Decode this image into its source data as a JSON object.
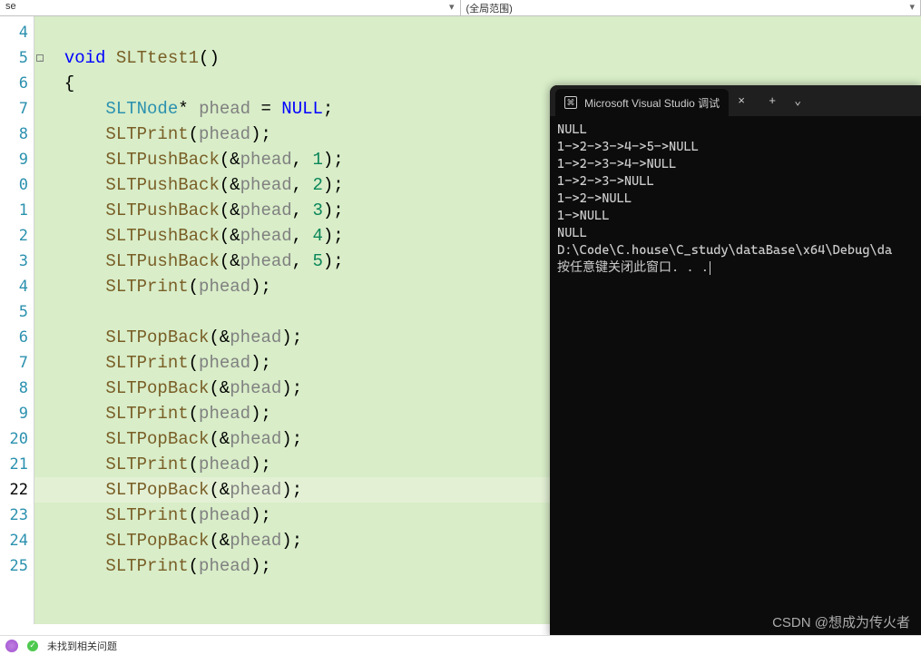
{
  "topbar": {
    "left_dropdown": "se",
    "right_dropdown": "(全局范围)"
  },
  "code": {
    "lines": [
      {
        "n": "4",
        "t": []
      },
      {
        "n": "5",
        "t": [
          {
            "s": "  ",
            "c": ""
          },
          {
            "s": "void",
            "c": "k-blue"
          },
          {
            "s": " ",
            "c": ""
          },
          {
            "s": "SLTtest1",
            "c": "k-func"
          },
          {
            "s": "()",
            "c": "k-par"
          }
        ],
        "outline": true
      },
      {
        "n": "6",
        "t": [
          {
            "s": "  {",
            "c": "k-par"
          }
        ]
      },
      {
        "n": "7",
        "t": [
          {
            "s": "      ",
            "c": ""
          },
          {
            "s": "SLTNode",
            "c": "k-type"
          },
          {
            "s": "* ",
            "c": "k-op"
          },
          {
            "s": "phead",
            "c": "hl-phead"
          },
          {
            "s": " = ",
            "c": "k-op"
          },
          {
            "s": "NULL",
            "c": "k-null"
          },
          {
            "s": ";",
            "c": "k-op"
          }
        ]
      },
      {
        "n": "8",
        "t": [
          {
            "s": "      ",
            "c": ""
          },
          {
            "s": "SLTPrint",
            "c": "k-func"
          },
          {
            "s": "(",
            "c": "k-par"
          },
          {
            "s": "phead",
            "c": "hl-phead"
          },
          {
            "s": ")",
            "c": "k-par"
          },
          {
            "s": ";",
            "c": "k-op"
          }
        ]
      },
      {
        "n": "9",
        "t": [
          {
            "s": "      ",
            "c": ""
          },
          {
            "s": "SLTPushBack",
            "c": "k-func"
          },
          {
            "s": "(&",
            "c": "k-par"
          },
          {
            "s": "phead",
            "c": "hl-phead"
          },
          {
            "s": ", ",
            "c": "k-op"
          },
          {
            "s": "1",
            "c": "k-num"
          },
          {
            "s": ")",
            "c": "k-par"
          },
          {
            "s": ";",
            "c": "k-op"
          }
        ]
      },
      {
        "n": "0",
        "t": [
          {
            "s": "      ",
            "c": ""
          },
          {
            "s": "SLTPushBack",
            "c": "k-func"
          },
          {
            "s": "(&",
            "c": "k-par"
          },
          {
            "s": "phead",
            "c": "hl-phead"
          },
          {
            "s": ", ",
            "c": "k-op"
          },
          {
            "s": "2",
            "c": "k-num"
          },
          {
            "s": ")",
            "c": "k-par"
          },
          {
            "s": ";",
            "c": "k-op"
          }
        ]
      },
      {
        "n": "1",
        "t": [
          {
            "s": "      ",
            "c": ""
          },
          {
            "s": "SLTPushBack",
            "c": "k-func"
          },
          {
            "s": "(&",
            "c": "k-par"
          },
          {
            "s": "phead",
            "c": "hl-phead"
          },
          {
            "s": ", ",
            "c": "k-op"
          },
          {
            "s": "3",
            "c": "k-num"
          },
          {
            "s": ")",
            "c": "k-par"
          },
          {
            "s": ";",
            "c": "k-op"
          }
        ]
      },
      {
        "n": "2",
        "t": [
          {
            "s": "      ",
            "c": ""
          },
          {
            "s": "SLTPushBack",
            "c": "k-func"
          },
          {
            "s": "(&",
            "c": "k-par"
          },
          {
            "s": "phead",
            "c": "hl-phead"
          },
          {
            "s": ", ",
            "c": "k-op"
          },
          {
            "s": "4",
            "c": "k-num"
          },
          {
            "s": ")",
            "c": "k-par"
          },
          {
            "s": ";",
            "c": "k-op"
          }
        ]
      },
      {
        "n": "3",
        "t": [
          {
            "s": "      ",
            "c": ""
          },
          {
            "s": "SLTPushBack",
            "c": "k-func"
          },
          {
            "s": "(&",
            "c": "k-par"
          },
          {
            "s": "phead",
            "c": "hl-phead"
          },
          {
            "s": ", ",
            "c": "k-op"
          },
          {
            "s": "5",
            "c": "k-num"
          },
          {
            "s": ")",
            "c": "k-par"
          },
          {
            "s": ";",
            "c": "k-op"
          }
        ]
      },
      {
        "n": "4",
        "t": [
          {
            "s": "      ",
            "c": ""
          },
          {
            "s": "SLTPrint",
            "c": "k-func"
          },
          {
            "s": "(",
            "c": "k-par"
          },
          {
            "s": "phead",
            "c": "hl-phead"
          },
          {
            "s": ")",
            "c": "k-par"
          },
          {
            "s": ";",
            "c": "k-op"
          }
        ]
      },
      {
        "n": "5",
        "t": []
      },
      {
        "n": "6",
        "t": [
          {
            "s": "      ",
            "c": ""
          },
          {
            "s": "SLTPopBack",
            "c": "k-func"
          },
          {
            "s": "(&",
            "c": "k-par"
          },
          {
            "s": "phead",
            "c": "hl-phead"
          },
          {
            "s": ")",
            "c": "k-par"
          },
          {
            "s": ";",
            "c": "k-op"
          }
        ]
      },
      {
        "n": "7",
        "t": [
          {
            "s": "      ",
            "c": ""
          },
          {
            "s": "SLTPrint",
            "c": "k-func"
          },
          {
            "s": "(",
            "c": "k-par"
          },
          {
            "s": "phead",
            "c": "hl-phead"
          },
          {
            "s": ")",
            "c": "k-par"
          },
          {
            "s": ";",
            "c": "k-op"
          }
        ]
      },
      {
        "n": "8",
        "t": [
          {
            "s": "      ",
            "c": ""
          },
          {
            "s": "SLTPopBack",
            "c": "k-func"
          },
          {
            "s": "(&",
            "c": "k-par"
          },
          {
            "s": "phead",
            "c": "hl-phead"
          },
          {
            "s": ")",
            "c": "k-par"
          },
          {
            "s": ";",
            "c": "k-op"
          }
        ]
      },
      {
        "n": "9",
        "t": [
          {
            "s": "      ",
            "c": ""
          },
          {
            "s": "SLTPrint",
            "c": "k-func"
          },
          {
            "s": "(",
            "c": "k-par"
          },
          {
            "s": "phead",
            "c": "hl-phead"
          },
          {
            "s": ")",
            "c": "k-par"
          },
          {
            "s": ";",
            "c": "k-op"
          }
        ]
      },
      {
        "n": "20",
        "t": [
          {
            "s": "      ",
            "c": ""
          },
          {
            "s": "SLTPopBack",
            "c": "k-func"
          },
          {
            "s": "(&",
            "c": "k-par"
          },
          {
            "s": "phead",
            "c": "hl-phead"
          },
          {
            "s": ")",
            "c": "k-par"
          },
          {
            "s": ";",
            "c": "k-op"
          }
        ]
      },
      {
        "n": "21",
        "t": [
          {
            "s": "      ",
            "c": ""
          },
          {
            "s": "SLTPrint",
            "c": "k-func"
          },
          {
            "s": "(",
            "c": "k-par"
          },
          {
            "s": "phead",
            "c": "hl-phead"
          },
          {
            "s": ")",
            "c": "k-par"
          },
          {
            "s": ";",
            "c": "k-op"
          }
        ]
      },
      {
        "n": "22",
        "t": [
          {
            "s": "      ",
            "c": ""
          },
          {
            "s": "SLTPopBack",
            "c": "k-func"
          },
          {
            "s": "(&",
            "c": "k-par"
          },
          {
            "s": "phead",
            "c": "hl-phead"
          },
          {
            "s": ")",
            "c": "k-par"
          },
          {
            "s": ";",
            "c": "k-op"
          }
        ],
        "active": true
      },
      {
        "n": "23",
        "t": [
          {
            "s": "      ",
            "c": ""
          },
          {
            "s": "SLTPrint",
            "c": "k-func"
          },
          {
            "s": "(",
            "c": "k-par"
          },
          {
            "s": "phead",
            "c": "hl-phead"
          },
          {
            "s": ")",
            "c": "k-par"
          },
          {
            "s": ";",
            "c": "k-op"
          }
        ]
      },
      {
        "n": "24",
        "t": [
          {
            "s": "      ",
            "c": ""
          },
          {
            "s": "SLTPopBack",
            "c": "k-func"
          },
          {
            "s": "(&",
            "c": "k-par"
          },
          {
            "s": "phead",
            "c": "hl-phead"
          },
          {
            "s": ")",
            "c": "k-par"
          },
          {
            "s": ";",
            "c": "k-op"
          }
        ]
      },
      {
        "n": "25",
        "t": [
          {
            "s": "      ",
            "c": ""
          },
          {
            "s": "SLTPrint",
            "c": "k-func"
          },
          {
            "s": "(",
            "c": "k-par"
          },
          {
            "s": "phead",
            "c": "hl-phead"
          },
          {
            "s": ")",
            "c": "k-par"
          },
          {
            "s": ";",
            "c": "k-op"
          }
        ]
      }
    ]
  },
  "terminal": {
    "tab_title": "Microsoft Visual Studio 调试",
    "icon_glyph": "⌘",
    "close": "×",
    "new": "+",
    "chev": "⌄",
    "output": [
      "NULL",
      "1->2->3->4->5->NULL",
      "1->2->3->4->NULL",
      "1->2->3->NULL",
      "1->2->NULL",
      "1->NULL",
      "NULL",
      "",
      "D:\\Code\\C.house\\C_study\\dataBase\\x64\\Debug\\da",
      "按任意键关闭此窗口. . ."
    ]
  },
  "status": {
    "ok_glyph": "✓",
    "no_issues": "未找到相关问题"
  },
  "watermark": "CSDN @想成为传火者"
}
